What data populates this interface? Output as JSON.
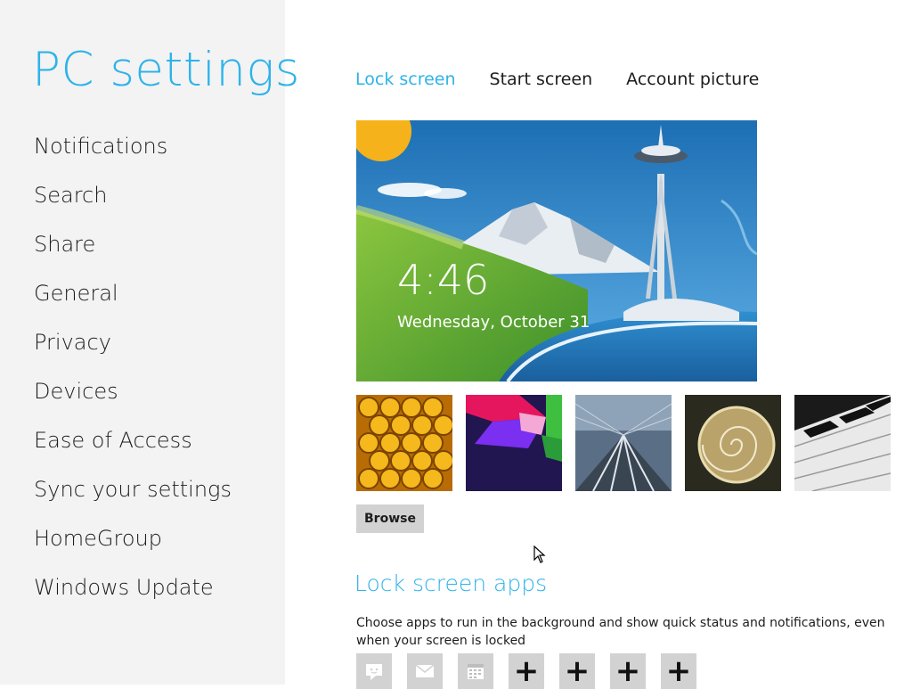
{
  "sidebar": {
    "title": "PC settings",
    "items": [
      {
        "label": "Notifications"
      },
      {
        "label": "Search"
      },
      {
        "label": "Share"
      },
      {
        "label": "General"
      },
      {
        "label": "Privacy"
      },
      {
        "label": "Devices"
      },
      {
        "label": "Ease of Access"
      },
      {
        "label": "Sync your settings"
      },
      {
        "label": "HomeGroup"
      },
      {
        "label": "Windows Update"
      }
    ]
  },
  "tabs": [
    {
      "label": "Lock screen",
      "active": true
    },
    {
      "label": "Start screen",
      "active": false
    },
    {
      "label": "Account picture",
      "active": false
    }
  ],
  "preview": {
    "time": "4:46",
    "date": "Wednesday, October 31"
  },
  "thumbnails": [
    "honeycomb",
    "geometric-shapes",
    "tunnel-tracks",
    "nautilus-shell",
    "piano-keys"
  ],
  "browse_label": "Browse",
  "lock_screen_apps": {
    "title": "Lock screen apps",
    "description": "Choose apps to run in the background and show quick status and notifications, even when your screen is locked",
    "slots": [
      {
        "type": "app",
        "icon": "messaging-icon"
      },
      {
        "type": "app",
        "icon": "mail-icon"
      },
      {
        "type": "app",
        "icon": "calendar-icon"
      },
      {
        "type": "add",
        "label": "+"
      },
      {
        "type": "add",
        "label": "+"
      },
      {
        "type": "add",
        "label": "+"
      },
      {
        "type": "add",
        "label": "+"
      }
    ]
  },
  "colors": {
    "accent": "#2eb3ea",
    "sidebar_bg": "#f3f3f3",
    "button_bg": "#d2d2d2"
  }
}
